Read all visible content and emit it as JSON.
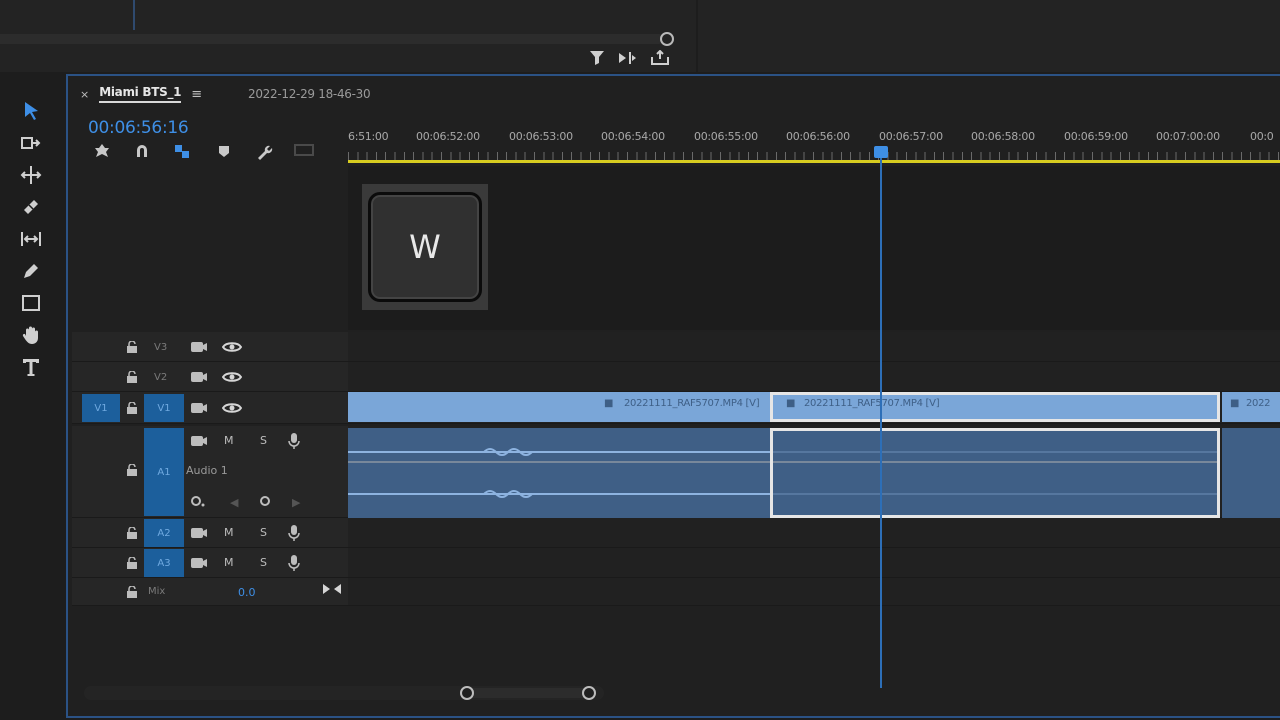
{
  "sequence": {
    "tab_name": "Miami BTS_1",
    "tab_close": "×",
    "tab_menu": "≡",
    "second_tab": "2022-12-29 18-46-30",
    "timecode": "00:06:56:16"
  },
  "ruler": {
    "labels": [
      "6:51:00",
      "00:06:52:00",
      "00:06:53:00",
      "00:06:54:00",
      "00:06:55:00",
      "00:06:56:00",
      "00:06:57:00",
      "00:06:58:00",
      "00:06:59:00",
      "00:07:00:00",
      "00:0"
    ]
  },
  "keyboard_overlay": {
    "key": "W"
  },
  "tracks": {
    "v3": "V3",
    "v2": "V2",
    "v1": "V1",
    "v1_source": "V1",
    "a1": "A1",
    "a1_name": "Audio 1",
    "a2": "A2",
    "a3": "A3",
    "mute": "M",
    "solo": "S",
    "mix_label": "Mix",
    "mix_value": "0.0"
  },
  "clips": {
    "clip1": "20221111_RAF5707.MP4 [V]",
    "clip2": "20221111_RAF5707.MP4 [V]",
    "clip3": "2022"
  },
  "colors": {
    "accent": "#3e8fe6",
    "video_clip": "#7aa6d8",
    "audio_clip": "#3f5f86",
    "work_area": "#d7cc20"
  }
}
